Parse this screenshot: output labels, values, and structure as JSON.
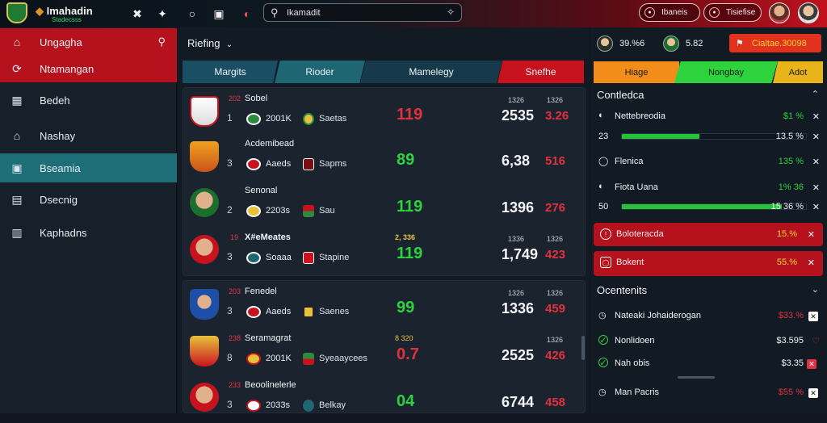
{
  "topbar": {
    "brand_title": "Imahadin",
    "brand_sub": "Stadecsss",
    "search_value": "Ikamadit",
    "pill1": "Ibaneis",
    "pill2": "Tisiefise"
  },
  "sidebar": {
    "items": [
      {
        "label": "Ungagha",
        "icon": "home-icon"
      },
      {
        "label": "Ntamangan",
        "icon": "refresh-icon"
      },
      {
        "label": "Bedeh",
        "icon": "doc-icon"
      },
      {
        "label": "Nashay",
        "icon": "house-icon"
      },
      {
        "label": "Bseamia",
        "icon": "store-icon"
      },
      {
        "label": "Dsecnig",
        "icon": "monitor-icon"
      },
      {
        "label": "Kaphadns",
        "icon": "building-icon"
      }
    ]
  },
  "main": {
    "subhead": "Riefing",
    "tabs": [
      "Margits",
      "Rioder",
      "Mamelegy",
      "Snefhe"
    ],
    "rows": [
      {
        "tag": "202",
        "name": "Sobel",
        "rank": "1",
        "team1": "2001K",
        "team2": "Saetas",
        "center_top": "",
        "big": "119",
        "big_color": "r",
        "ctop": "1326",
        "cbig": "2535",
        "rtop": "1326",
        "rbig": "3.26"
      },
      {
        "tag": "",
        "name": "Acdemibead",
        "rank": "3",
        "team1": "Aaeds",
        "team2": "Sapms",
        "center_top": "",
        "big": "89",
        "big_color": "g",
        "ctop": "",
        "cbig": "6,38",
        "rtop": "",
        "rbig": "516"
      },
      {
        "tag": "",
        "name": "Senonal",
        "rank": "2",
        "team1": "2203s",
        "team2": "Sau",
        "center_top": "",
        "big": "119",
        "big_color": "g",
        "ctop": "",
        "cbig": "1396",
        "rtop": "",
        "rbig": "276"
      },
      {
        "tag": "19",
        "name": "X#eMeates",
        "rank": "3",
        "team1": "Soaaa",
        "team2": "Stapine",
        "center_top": "2, 336",
        "big": "119",
        "big_color": "g",
        "ctop": "1336",
        "cbig": "1,749",
        "rtop": "1326",
        "rbig": "423"
      },
      {
        "tag": "203",
        "name": "Fenedel",
        "rank": "3",
        "team1": "Aaeds",
        "team2": "Saenes",
        "center_top": "",
        "big": "99",
        "big_color": "g",
        "ctop": "1326",
        "cbig": "1336",
        "rtop": "1326",
        "rbig": "459"
      },
      {
        "tag": "238",
        "name": "Seramagrat",
        "rank": "8",
        "team1": "2001K",
        "team2": "Syeaaycees",
        "center_top": "8 320",
        "big": "0.7",
        "big_color": "r",
        "ctop": "",
        "cbig": "2525",
        "rtop": "1326",
        "rbig": "426"
      },
      {
        "tag": "233",
        "name": "Beoolinelerle",
        "rank": "3",
        "team1": "2033s",
        "team2": "Belkay",
        "center_top": "",
        "big": "04",
        "big_color": "g",
        "ctop": "",
        "cbig": "6744",
        "rtop": "",
        "rbig": "458"
      }
    ]
  },
  "right": {
    "chip1": "39.%6",
    "chip2": "5.82",
    "chip3": "Cialtae.30098",
    "tabs": [
      "Hiage",
      "Nongbay",
      "Adot"
    ],
    "section1_title": "Contledca",
    "lines1": [
      {
        "text": "Nettebreodia",
        "value": "$1 %"
      },
      {
        "text": "23",
        "value": "13.5 %"
      },
      {
        "text": "Flenica",
        "value": "135 %"
      },
      {
        "text": "Fiota Uana",
        "value": "1% 36"
      },
      {
        "text": "50",
        "value": "15 36 %"
      }
    ],
    "bar1": 0.42,
    "bar2": 0.87,
    "alert1": {
      "text": "Boloteracda",
      "value": "15.%"
    },
    "alert2": {
      "text": "Bokent",
      "value": "55.%"
    },
    "section2_title": "Ocentenits",
    "lines2": [
      {
        "text": "Nateaki Johaiderogan",
        "value": "$33.%"
      },
      {
        "text": "Nonlidoen",
        "value": "$3.595"
      },
      {
        "text": "Nah obis",
        "value": "$3.35"
      },
      {
        "text": "Man Pacris",
        "value": "$55 %"
      }
    ]
  }
}
